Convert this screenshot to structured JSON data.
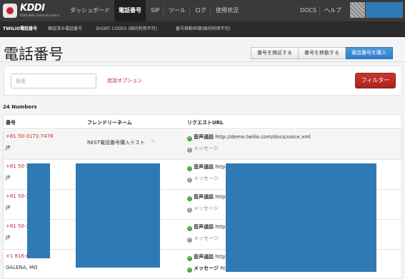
{
  "colors": {
    "nav_bg": "#3a3a3a",
    "subnav_bg": "#2b2b2b",
    "accent_blue": "#2f7fcf",
    "accent_red": "#c62828",
    "redaction": "#2f7ab5"
  },
  "brand": {
    "name": "KDDI",
    "sub": "KDDI Web Communications"
  },
  "nav": {
    "items": [
      "ダッシュボード",
      "電話番号",
      "SIP",
      "ツール",
      "ログ",
      "使用状況"
    ],
    "active": "電話番号",
    "docs": "DOCS",
    "help": "ヘルプ"
  },
  "subnav": {
    "items": [
      "TWILIO電話番号",
      "検証済み電話番号",
      "SHORT CODES (国内利用不可)",
      "番号移動申請(国内利用不可)"
    ]
  },
  "page": {
    "title": "電話番号",
    "actions": [
      "番号を検証する",
      "番号を移動する",
      "電話番号を購入"
    ]
  },
  "filter": {
    "search_placeholder": "検索",
    "add_option": "追加オプション",
    "filter_button": "フィルター"
  },
  "count": "24 Numbers",
  "table": {
    "headers": [
      "番号",
      "フレンドリーネーム",
      "リクエストURL"
    ],
    "voice_label": "音声通話",
    "message_label": "メッセージ",
    "rows": [
      {
        "number": "+81 50-3171-7476",
        "location": "JP",
        "friendly": "REST電話番号購入テスト",
        "url": "http://demo.twilio.com/docs/voice.xml"
      },
      {
        "number": "+81 50-3",
        "location": "JP",
        "friendly": "",
        "url": "http"
      },
      {
        "number": "+81 50-3",
        "location": "JP",
        "friendly": "",
        "url": "http"
      },
      {
        "number": "+81 50-3",
        "location": "JP",
        "friendly": "",
        "url": "http"
      },
      {
        "number": "+1 816-6",
        "location": "GALENA, MO",
        "friendly": "",
        "url": "http",
        "message_url": "htt"
      }
    ]
  }
}
